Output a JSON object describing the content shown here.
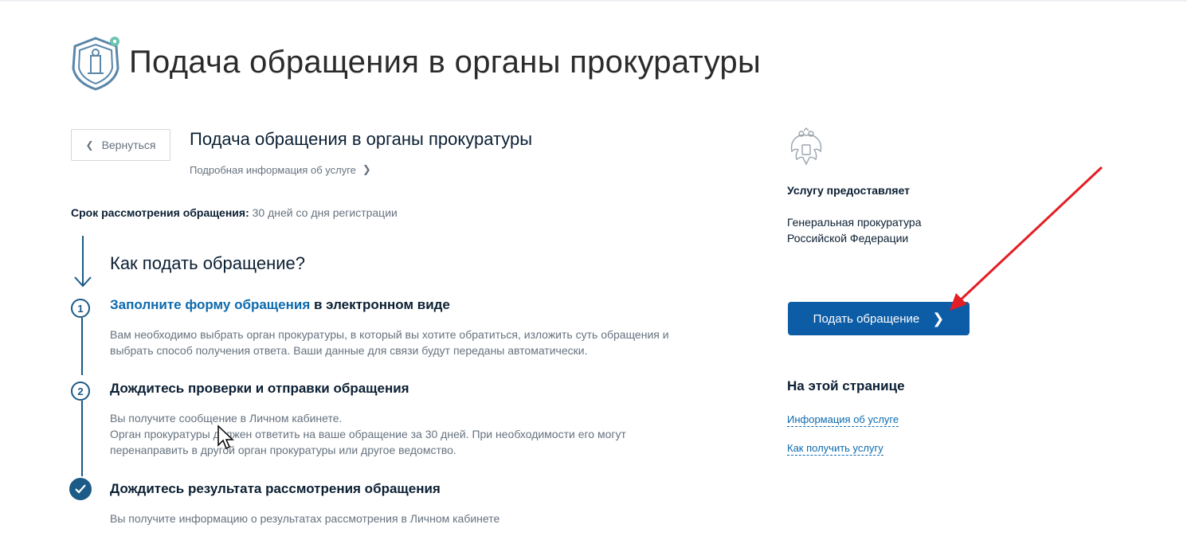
{
  "header": {
    "title": "Подача обращения в органы прокуратуры",
    "logo_icon": "prosecutor-shield-logo"
  },
  "service": {
    "back_label": "Вернуться",
    "title": "Подача обращения в органы прокуратуры",
    "info_link": "Подробная информация об услуге",
    "deadline_label": "Срок рассмотрения обращения:",
    "deadline_value": "30 дней со дня регистрации"
  },
  "how_to": {
    "title": "Как подать обращение?",
    "steps": [
      {
        "number": "1",
        "link_text": "Заполните форму обращения",
        "heading_rest": " в электронном виде",
        "lines": [
          "Вам необходимо выбрать орган прокуратуры, в который вы хотите обратиться, изложить суть обращения и",
          "выбрать способ получения ответа. Ваши данные для связи будут переданы автоматически."
        ]
      },
      {
        "number": "2",
        "heading": "Дождитесь проверки и отправки обращения",
        "lines": [
          "Вы получите сообщение в Личном кабинете.",
          "Орган прокуратуры должен ответить на ваше обращение за 30 дней. При необходимости его могут",
          "перенаправить в другой орган прокуратуры или другое ведомство."
        ]
      },
      {
        "number": "",
        "heading": "Дождитесь результата рассмотрения обращения",
        "lines": [
          "Вы получите информацию о результатах рассмотрения в Личном кабинете"
        ]
      }
    ]
  },
  "sidebar": {
    "emblem_icon": "russian-coat-of-arms",
    "provider_label": "Услугу предоставляет",
    "provider_name_lines": [
      "Генеральная прокуратура",
      "Российской Федерации"
    ],
    "submit_label": "Подать обращение",
    "on_page_title": "На этой странице",
    "on_page_links": [
      "Информация об услуге",
      "Как получить услугу"
    ]
  },
  "colors": {
    "primary": "#0d5ca6",
    "link": "#0d6aad",
    "step": "#1c5a87",
    "annotation": "#e31e24"
  }
}
